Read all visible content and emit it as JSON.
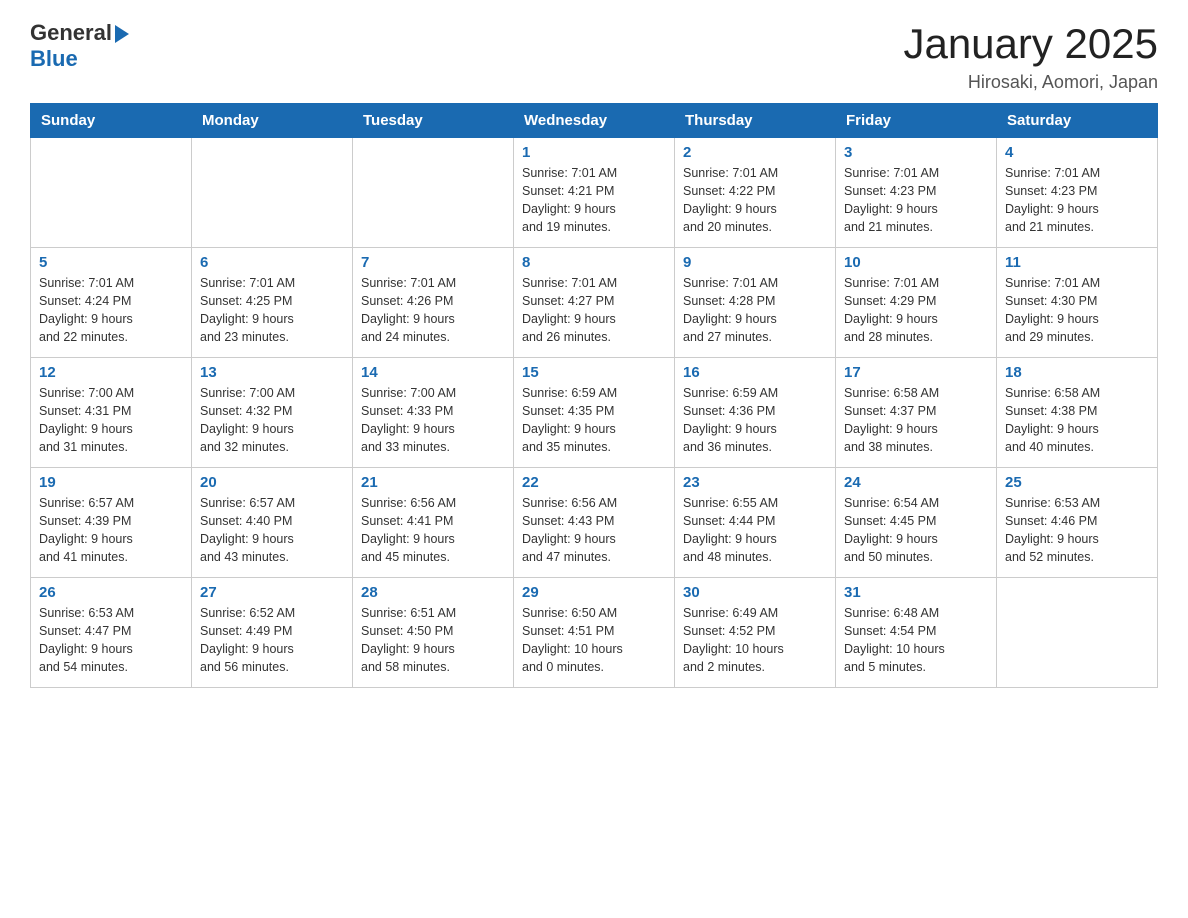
{
  "header": {
    "logo_general": "General",
    "logo_blue": "Blue",
    "title": "January 2025",
    "location": "Hirosaki, Aomori, Japan"
  },
  "days_of_week": [
    "Sunday",
    "Monday",
    "Tuesday",
    "Wednesday",
    "Thursday",
    "Friday",
    "Saturday"
  ],
  "weeks": [
    [
      {
        "day": "",
        "info": ""
      },
      {
        "day": "",
        "info": ""
      },
      {
        "day": "",
        "info": ""
      },
      {
        "day": "1",
        "info": "Sunrise: 7:01 AM\nSunset: 4:21 PM\nDaylight: 9 hours\nand 19 minutes."
      },
      {
        "day": "2",
        "info": "Sunrise: 7:01 AM\nSunset: 4:22 PM\nDaylight: 9 hours\nand 20 minutes."
      },
      {
        "day": "3",
        "info": "Sunrise: 7:01 AM\nSunset: 4:23 PM\nDaylight: 9 hours\nand 21 minutes."
      },
      {
        "day": "4",
        "info": "Sunrise: 7:01 AM\nSunset: 4:23 PM\nDaylight: 9 hours\nand 21 minutes."
      }
    ],
    [
      {
        "day": "5",
        "info": "Sunrise: 7:01 AM\nSunset: 4:24 PM\nDaylight: 9 hours\nand 22 minutes."
      },
      {
        "day": "6",
        "info": "Sunrise: 7:01 AM\nSunset: 4:25 PM\nDaylight: 9 hours\nand 23 minutes."
      },
      {
        "day": "7",
        "info": "Sunrise: 7:01 AM\nSunset: 4:26 PM\nDaylight: 9 hours\nand 24 minutes."
      },
      {
        "day": "8",
        "info": "Sunrise: 7:01 AM\nSunset: 4:27 PM\nDaylight: 9 hours\nand 26 minutes."
      },
      {
        "day": "9",
        "info": "Sunrise: 7:01 AM\nSunset: 4:28 PM\nDaylight: 9 hours\nand 27 minutes."
      },
      {
        "day": "10",
        "info": "Sunrise: 7:01 AM\nSunset: 4:29 PM\nDaylight: 9 hours\nand 28 minutes."
      },
      {
        "day": "11",
        "info": "Sunrise: 7:01 AM\nSunset: 4:30 PM\nDaylight: 9 hours\nand 29 minutes."
      }
    ],
    [
      {
        "day": "12",
        "info": "Sunrise: 7:00 AM\nSunset: 4:31 PM\nDaylight: 9 hours\nand 31 minutes."
      },
      {
        "day": "13",
        "info": "Sunrise: 7:00 AM\nSunset: 4:32 PM\nDaylight: 9 hours\nand 32 minutes."
      },
      {
        "day": "14",
        "info": "Sunrise: 7:00 AM\nSunset: 4:33 PM\nDaylight: 9 hours\nand 33 minutes."
      },
      {
        "day": "15",
        "info": "Sunrise: 6:59 AM\nSunset: 4:35 PM\nDaylight: 9 hours\nand 35 minutes."
      },
      {
        "day": "16",
        "info": "Sunrise: 6:59 AM\nSunset: 4:36 PM\nDaylight: 9 hours\nand 36 minutes."
      },
      {
        "day": "17",
        "info": "Sunrise: 6:58 AM\nSunset: 4:37 PM\nDaylight: 9 hours\nand 38 minutes."
      },
      {
        "day": "18",
        "info": "Sunrise: 6:58 AM\nSunset: 4:38 PM\nDaylight: 9 hours\nand 40 minutes."
      }
    ],
    [
      {
        "day": "19",
        "info": "Sunrise: 6:57 AM\nSunset: 4:39 PM\nDaylight: 9 hours\nand 41 minutes."
      },
      {
        "day": "20",
        "info": "Sunrise: 6:57 AM\nSunset: 4:40 PM\nDaylight: 9 hours\nand 43 minutes."
      },
      {
        "day": "21",
        "info": "Sunrise: 6:56 AM\nSunset: 4:41 PM\nDaylight: 9 hours\nand 45 minutes."
      },
      {
        "day": "22",
        "info": "Sunrise: 6:56 AM\nSunset: 4:43 PM\nDaylight: 9 hours\nand 47 minutes."
      },
      {
        "day": "23",
        "info": "Sunrise: 6:55 AM\nSunset: 4:44 PM\nDaylight: 9 hours\nand 48 minutes."
      },
      {
        "day": "24",
        "info": "Sunrise: 6:54 AM\nSunset: 4:45 PM\nDaylight: 9 hours\nand 50 minutes."
      },
      {
        "day": "25",
        "info": "Sunrise: 6:53 AM\nSunset: 4:46 PM\nDaylight: 9 hours\nand 52 minutes."
      }
    ],
    [
      {
        "day": "26",
        "info": "Sunrise: 6:53 AM\nSunset: 4:47 PM\nDaylight: 9 hours\nand 54 minutes."
      },
      {
        "day": "27",
        "info": "Sunrise: 6:52 AM\nSunset: 4:49 PM\nDaylight: 9 hours\nand 56 minutes."
      },
      {
        "day": "28",
        "info": "Sunrise: 6:51 AM\nSunset: 4:50 PM\nDaylight: 9 hours\nand 58 minutes."
      },
      {
        "day": "29",
        "info": "Sunrise: 6:50 AM\nSunset: 4:51 PM\nDaylight: 10 hours\nand 0 minutes."
      },
      {
        "day": "30",
        "info": "Sunrise: 6:49 AM\nSunset: 4:52 PM\nDaylight: 10 hours\nand 2 minutes."
      },
      {
        "day": "31",
        "info": "Sunrise: 6:48 AM\nSunset: 4:54 PM\nDaylight: 10 hours\nand 5 minutes."
      },
      {
        "day": "",
        "info": ""
      }
    ]
  ]
}
